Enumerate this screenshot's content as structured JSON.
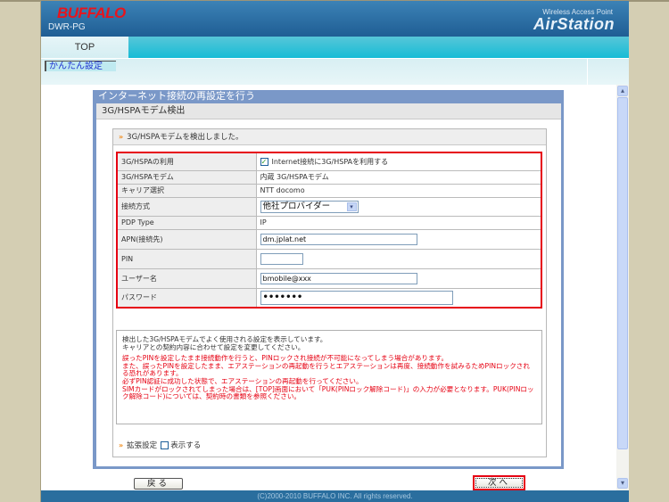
{
  "header": {
    "brand": "BUFFALO",
    "model": "DWR-PG",
    "product_subtitle": "Wireless Access Point",
    "product_name": "AirStation"
  },
  "nav": {
    "tabs": [
      {
        "label": "TOP",
        "active": true
      }
    ],
    "subnav": [
      {
        "label": "かんたん設定",
        "active": true
      }
    ]
  },
  "panel": {
    "title": "インターネット接続の再設定を行う",
    "subtitle": "3G/HSPAモデム検出",
    "message": "3G/HSPAモデムを検出しました。",
    "settings": {
      "use_3g": {
        "label": "3G/HSPAの利用",
        "checkbox_label": "Internet接続に3G/HSPAを利用する",
        "checked": true
      },
      "modem": {
        "label": "3G/HSPAモデム",
        "value": "内蔵 3G/HSPAモデム"
      },
      "carrier": {
        "label": "キャリア選択",
        "value": "NTT docomo"
      },
      "connection": {
        "label": "接続方式",
        "selected": "他社プロバイダー"
      },
      "pdp_type": {
        "label": "PDP Type",
        "value": "IP"
      },
      "apn": {
        "label": "APN(接続先)",
        "value": "dm.jplat.net"
      },
      "pin": {
        "label": "PIN",
        "value": ""
      },
      "username": {
        "label": "ユーザー名",
        "value": "bmobile@xxx"
      },
      "password": {
        "label": "パスワード",
        "value": "•••••••"
      }
    },
    "notes": {
      "info": [
        "検出した3G/HSPAモデムでよく使用される設定を表示しています。",
        "キャリアとの契約内容に合わせて設定を変更してください。"
      ],
      "warnings": [
        "誤ったPINを設定したまま接続動作を行うと、PINロックされ接続が不可能になってしまう場合があります。",
        "また、誤ったPINを設定したまま、エアステーションの再起動を行うとエアステーションは再度、接続動作を試みるためPINロックされる恐れがあります。",
        "必ずPIN認証に成功した状態で、エアステーションの再起動を行ってください。",
        "SIMカードがロックされてしまった場合は、[TOP]画面において「PUK(PINロック解除コード)」の入力が必要となります。PUK(PINロック解除コード)については、契約時の書類を参照ください。"
      ]
    },
    "extended": {
      "label": "拡張設定",
      "checkbox_label": "表示する",
      "checked": false
    }
  },
  "buttons": {
    "back": "戻る",
    "next": "次へ"
  },
  "footer": {
    "copyright": "(C)2000-2010 BUFFALO INC. All rights reserved."
  },
  "colors": {
    "brand_red": "#e8141c",
    "highlight_red": "#e60012",
    "header_blue": "#1f5e94",
    "nav_cyan": "#16bcd6",
    "panel_blue": "#7a98c8"
  }
}
